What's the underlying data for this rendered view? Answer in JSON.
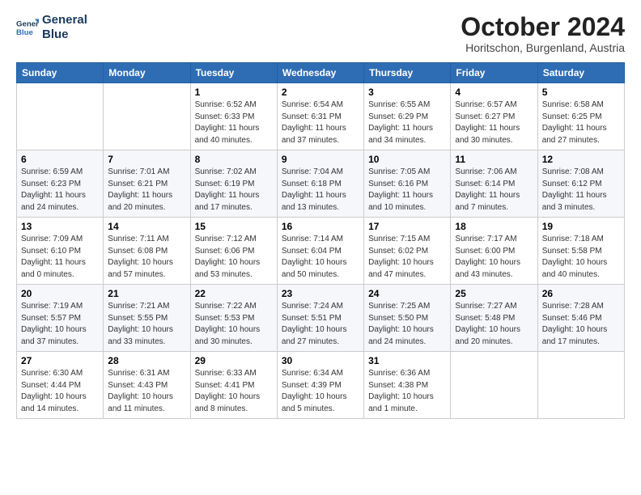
{
  "header": {
    "logo_line1": "General",
    "logo_line2": "Blue",
    "month_title": "October 2024",
    "subtitle": "Horitschon, Burgenland, Austria"
  },
  "weekdays": [
    "Sunday",
    "Monday",
    "Tuesday",
    "Wednesday",
    "Thursday",
    "Friday",
    "Saturday"
  ],
  "weeks": [
    [
      {
        "day": "",
        "info": ""
      },
      {
        "day": "",
        "info": ""
      },
      {
        "day": "1",
        "info": "Sunrise: 6:52 AM\nSunset: 6:33 PM\nDaylight: 11 hours and 40 minutes."
      },
      {
        "day": "2",
        "info": "Sunrise: 6:54 AM\nSunset: 6:31 PM\nDaylight: 11 hours and 37 minutes."
      },
      {
        "day": "3",
        "info": "Sunrise: 6:55 AM\nSunset: 6:29 PM\nDaylight: 11 hours and 34 minutes."
      },
      {
        "day": "4",
        "info": "Sunrise: 6:57 AM\nSunset: 6:27 PM\nDaylight: 11 hours and 30 minutes."
      },
      {
        "day": "5",
        "info": "Sunrise: 6:58 AM\nSunset: 6:25 PM\nDaylight: 11 hours and 27 minutes."
      }
    ],
    [
      {
        "day": "6",
        "info": "Sunrise: 6:59 AM\nSunset: 6:23 PM\nDaylight: 11 hours and 24 minutes."
      },
      {
        "day": "7",
        "info": "Sunrise: 7:01 AM\nSunset: 6:21 PM\nDaylight: 11 hours and 20 minutes."
      },
      {
        "day": "8",
        "info": "Sunrise: 7:02 AM\nSunset: 6:19 PM\nDaylight: 11 hours and 17 minutes."
      },
      {
        "day": "9",
        "info": "Sunrise: 7:04 AM\nSunset: 6:18 PM\nDaylight: 11 hours and 13 minutes."
      },
      {
        "day": "10",
        "info": "Sunrise: 7:05 AM\nSunset: 6:16 PM\nDaylight: 11 hours and 10 minutes."
      },
      {
        "day": "11",
        "info": "Sunrise: 7:06 AM\nSunset: 6:14 PM\nDaylight: 11 hours and 7 minutes."
      },
      {
        "day": "12",
        "info": "Sunrise: 7:08 AM\nSunset: 6:12 PM\nDaylight: 11 hours and 3 minutes."
      }
    ],
    [
      {
        "day": "13",
        "info": "Sunrise: 7:09 AM\nSunset: 6:10 PM\nDaylight: 11 hours and 0 minutes."
      },
      {
        "day": "14",
        "info": "Sunrise: 7:11 AM\nSunset: 6:08 PM\nDaylight: 10 hours and 57 minutes."
      },
      {
        "day": "15",
        "info": "Sunrise: 7:12 AM\nSunset: 6:06 PM\nDaylight: 10 hours and 53 minutes."
      },
      {
        "day": "16",
        "info": "Sunrise: 7:14 AM\nSunset: 6:04 PM\nDaylight: 10 hours and 50 minutes."
      },
      {
        "day": "17",
        "info": "Sunrise: 7:15 AM\nSunset: 6:02 PM\nDaylight: 10 hours and 47 minutes."
      },
      {
        "day": "18",
        "info": "Sunrise: 7:17 AM\nSunset: 6:00 PM\nDaylight: 10 hours and 43 minutes."
      },
      {
        "day": "19",
        "info": "Sunrise: 7:18 AM\nSunset: 5:58 PM\nDaylight: 10 hours and 40 minutes."
      }
    ],
    [
      {
        "day": "20",
        "info": "Sunrise: 7:19 AM\nSunset: 5:57 PM\nDaylight: 10 hours and 37 minutes."
      },
      {
        "day": "21",
        "info": "Sunrise: 7:21 AM\nSunset: 5:55 PM\nDaylight: 10 hours and 33 minutes."
      },
      {
        "day": "22",
        "info": "Sunrise: 7:22 AM\nSunset: 5:53 PM\nDaylight: 10 hours and 30 minutes."
      },
      {
        "day": "23",
        "info": "Sunrise: 7:24 AM\nSunset: 5:51 PM\nDaylight: 10 hours and 27 minutes."
      },
      {
        "day": "24",
        "info": "Sunrise: 7:25 AM\nSunset: 5:50 PM\nDaylight: 10 hours and 24 minutes."
      },
      {
        "day": "25",
        "info": "Sunrise: 7:27 AM\nSunset: 5:48 PM\nDaylight: 10 hours and 20 minutes."
      },
      {
        "day": "26",
        "info": "Sunrise: 7:28 AM\nSunset: 5:46 PM\nDaylight: 10 hours and 17 minutes."
      }
    ],
    [
      {
        "day": "27",
        "info": "Sunrise: 6:30 AM\nSunset: 4:44 PM\nDaylight: 10 hours and 14 minutes."
      },
      {
        "day": "28",
        "info": "Sunrise: 6:31 AM\nSunset: 4:43 PM\nDaylight: 10 hours and 11 minutes."
      },
      {
        "day": "29",
        "info": "Sunrise: 6:33 AM\nSunset: 4:41 PM\nDaylight: 10 hours and 8 minutes."
      },
      {
        "day": "30",
        "info": "Sunrise: 6:34 AM\nSunset: 4:39 PM\nDaylight: 10 hours and 5 minutes."
      },
      {
        "day": "31",
        "info": "Sunrise: 6:36 AM\nSunset: 4:38 PM\nDaylight: 10 hours and 1 minute."
      },
      {
        "day": "",
        "info": ""
      },
      {
        "day": "",
        "info": ""
      }
    ]
  ]
}
